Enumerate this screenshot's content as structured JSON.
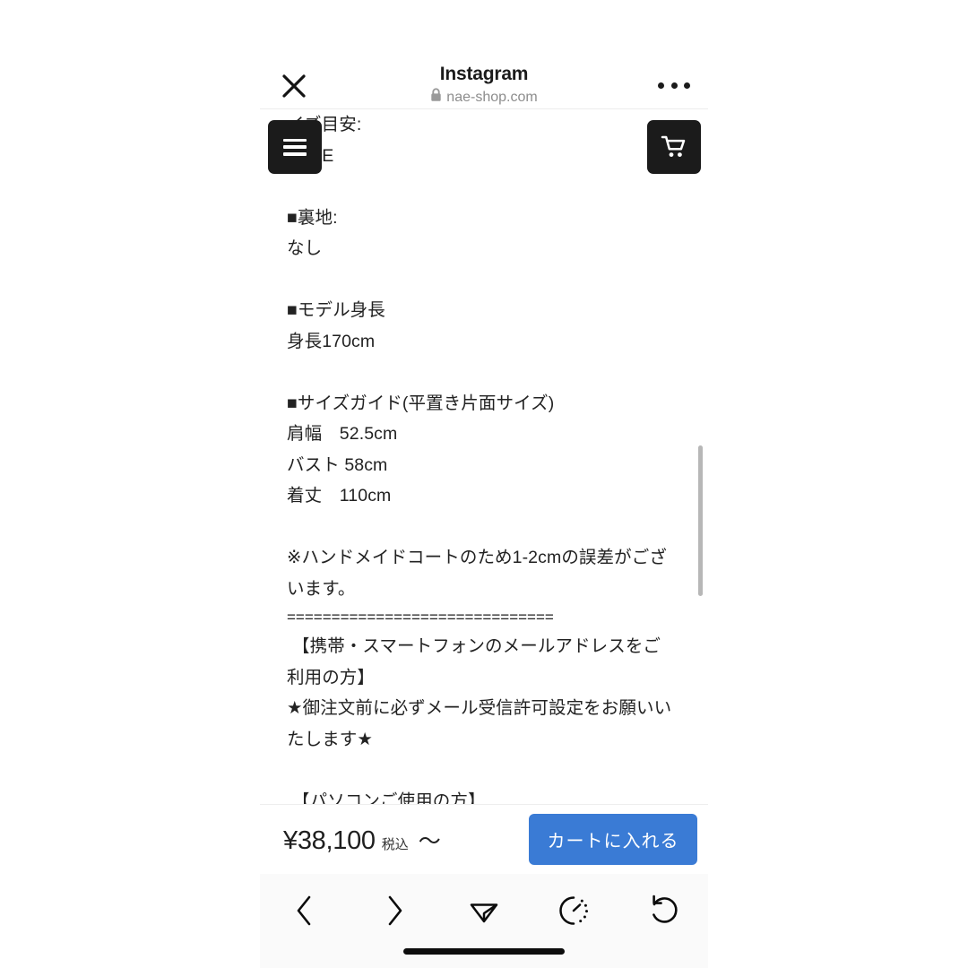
{
  "header": {
    "title": "Instagram",
    "url": "nae-shop.com",
    "close_icon": "close-x-icon",
    "lock_icon": "lock-icon",
    "more_icon": "more-options-icon"
  },
  "page": {
    "menu_icon": "hamburger-menu-icon",
    "cart_icon": "shopping-cart-icon",
    "description_lines": [
      {
        "text": "イズ目安:",
        "style": "normal"
      },
      {
        "text": "FREE",
        "style": "normal"
      },
      {
        "text": "",
        "style": "blank"
      },
      {
        "text": "■裏地:",
        "style": "normal"
      },
      {
        "text": "なし",
        "style": "normal"
      },
      {
        "text": "",
        "style": "blank"
      },
      {
        "text": "■モデル身長",
        "style": "normal"
      },
      {
        "text": "身長170cm",
        "style": "normal"
      },
      {
        "text": "",
        "style": "blank"
      },
      {
        "text": "■サイズガイド(平置き片面サイズ)",
        "style": "normal"
      },
      {
        "text": "肩幅　52.5cm",
        "style": "normal"
      },
      {
        "text": "バスト 58cm",
        "style": "normal"
      },
      {
        "text": "着丈　110cm",
        "style": "normal"
      },
      {
        "text": "",
        "style": "blank"
      },
      {
        "text": "※ハンドメイドコートのため1-2cmの誤差がございます。",
        "style": "normal"
      },
      {
        "text": "==============================",
        "style": "eqline"
      },
      {
        "text": "【携帯・スマートフォンのメールアドレスをご利用の方】",
        "style": "indent"
      },
      {
        "text": "★御注文前に必ずメール受信許可設定をお願いいたします★",
        "style": "normal"
      },
      {
        "text": "",
        "style": "blank"
      },
      {
        "text": "【パソコンご使用の方】",
        "style": "indent"
      }
    ]
  },
  "buy_bar": {
    "price": "¥38,100",
    "tax_label": "税込",
    "from_label": "〜",
    "cart_button_label": "カートに入れる",
    "cart_button_color": "#3a7bd5"
  },
  "browser_toolbar": {
    "buttons": [
      {
        "name": "back-icon",
        "label": "Back"
      },
      {
        "name": "forward-icon",
        "label": "Forward"
      },
      {
        "name": "share-icon",
        "label": "Share"
      },
      {
        "name": "reading-list-clock-icon",
        "label": "Reading List"
      },
      {
        "name": "reload-icon",
        "label": "Reload"
      }
    ]
  }
}
